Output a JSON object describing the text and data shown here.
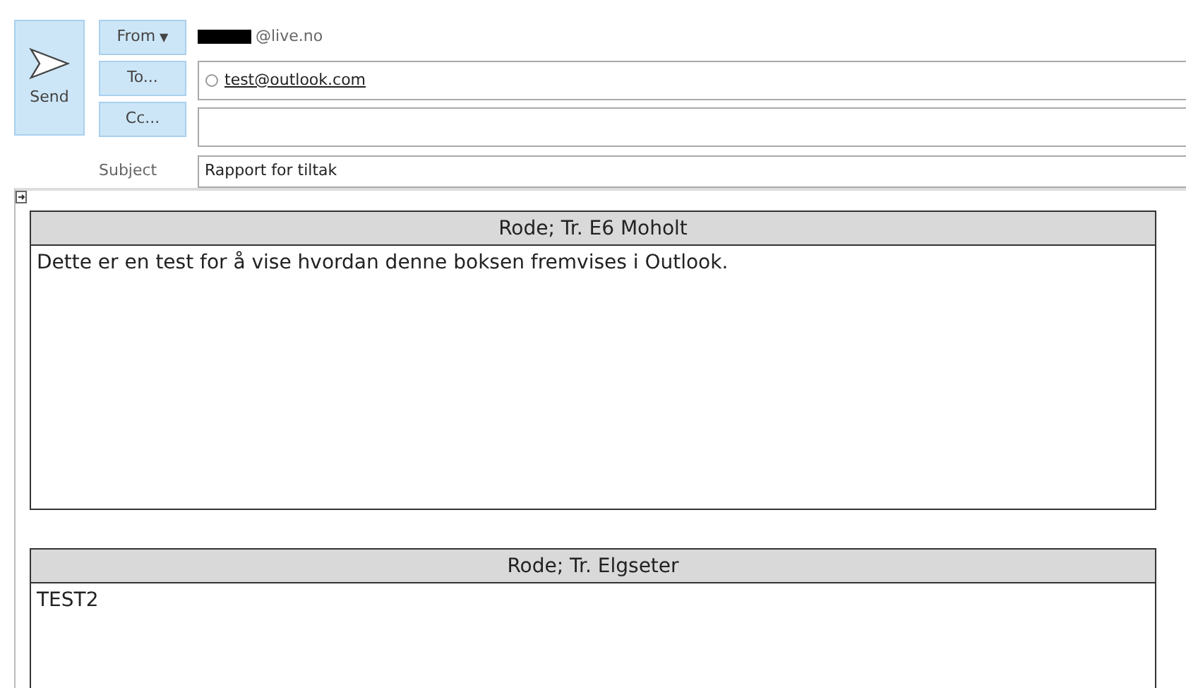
{
  "send_button": {
    "label": "Send"
  },
  "from": {
    "button": "From",
    "caret": "▼",
    "address": "@live.no"
  },
  "to": {
    "button": "To...",
    "recipient": "test@outlook.com"
  },
  "cc": {
    "button": "Cc..."
  },
  "subject": {
    "label": "Subject",
    "value": "Rapport for tiltak"
  },
  "tables": [
    {
      "header": "Rode; Tr. E6 Moholt",
      "body": "Dette er en test for å vise hvordan denne boksen fremvises i Outlook."
    },
    {
      "header": "Rode; Tr. Elgseter",
      "body": "TEST2"
    }
  ]
}
